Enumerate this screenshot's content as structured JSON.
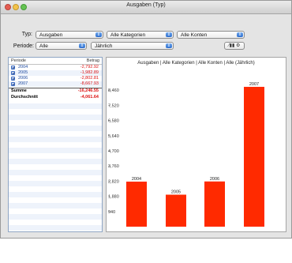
{
  "window": {
    "title": "Ausgaben (Typ)"
  },
  "filters": {
    "typ_label": "Typ:",
    "typ_value": "Ausgaben",
    "category_value": "Alle Kategorien",
    "account_value": "Alle Konten",
    "periode_label": "Periode:",
    "periode_value": "Alle",
    "interval_value": "Jährlich"
  },
  "table": {
    "col_period": "Periode",
    "col_amount": "Betrag",
    "rows": [
      {
        "label": "2004",
        "value": "-2,792.92"
      },
      {
        "label": "2005",
        "value": "-1,982.89"
      },
      {
        "label": "2006",
        "value": "-2,802.81"
      },
      {
        "label": "2007",
        "value": "-8,667.93"
      }
    ],
    "sum_label": "Summe",
    "sum_value": "-16,246.55",
    "avg_label": "Durchschnitt",
    "avg_value": "-4,061.64"
  },
  "chart_data": {
    "type": "bar",
    "title": "Ausgaben | Alle Kategorien | Alle Konten | Alle (Jährlich)",
    "categories": [
      "2004",
      "2005",
      "2006",
      "2007"
    ],
    "values": [
      2792.92,
      1982.89,
      2802.81,
      8667.93
    ],
    "yticks": [
      "940",
      "1,880",
      "2,820",
      "3,760",
      "4,700",
      "5,640",
      "6,580",
      "7,520",
      "8,460"
    ],
    "ylim": [
      0,
      9400
    ],
    "bar_color": "#ff2a00"
  }
}
